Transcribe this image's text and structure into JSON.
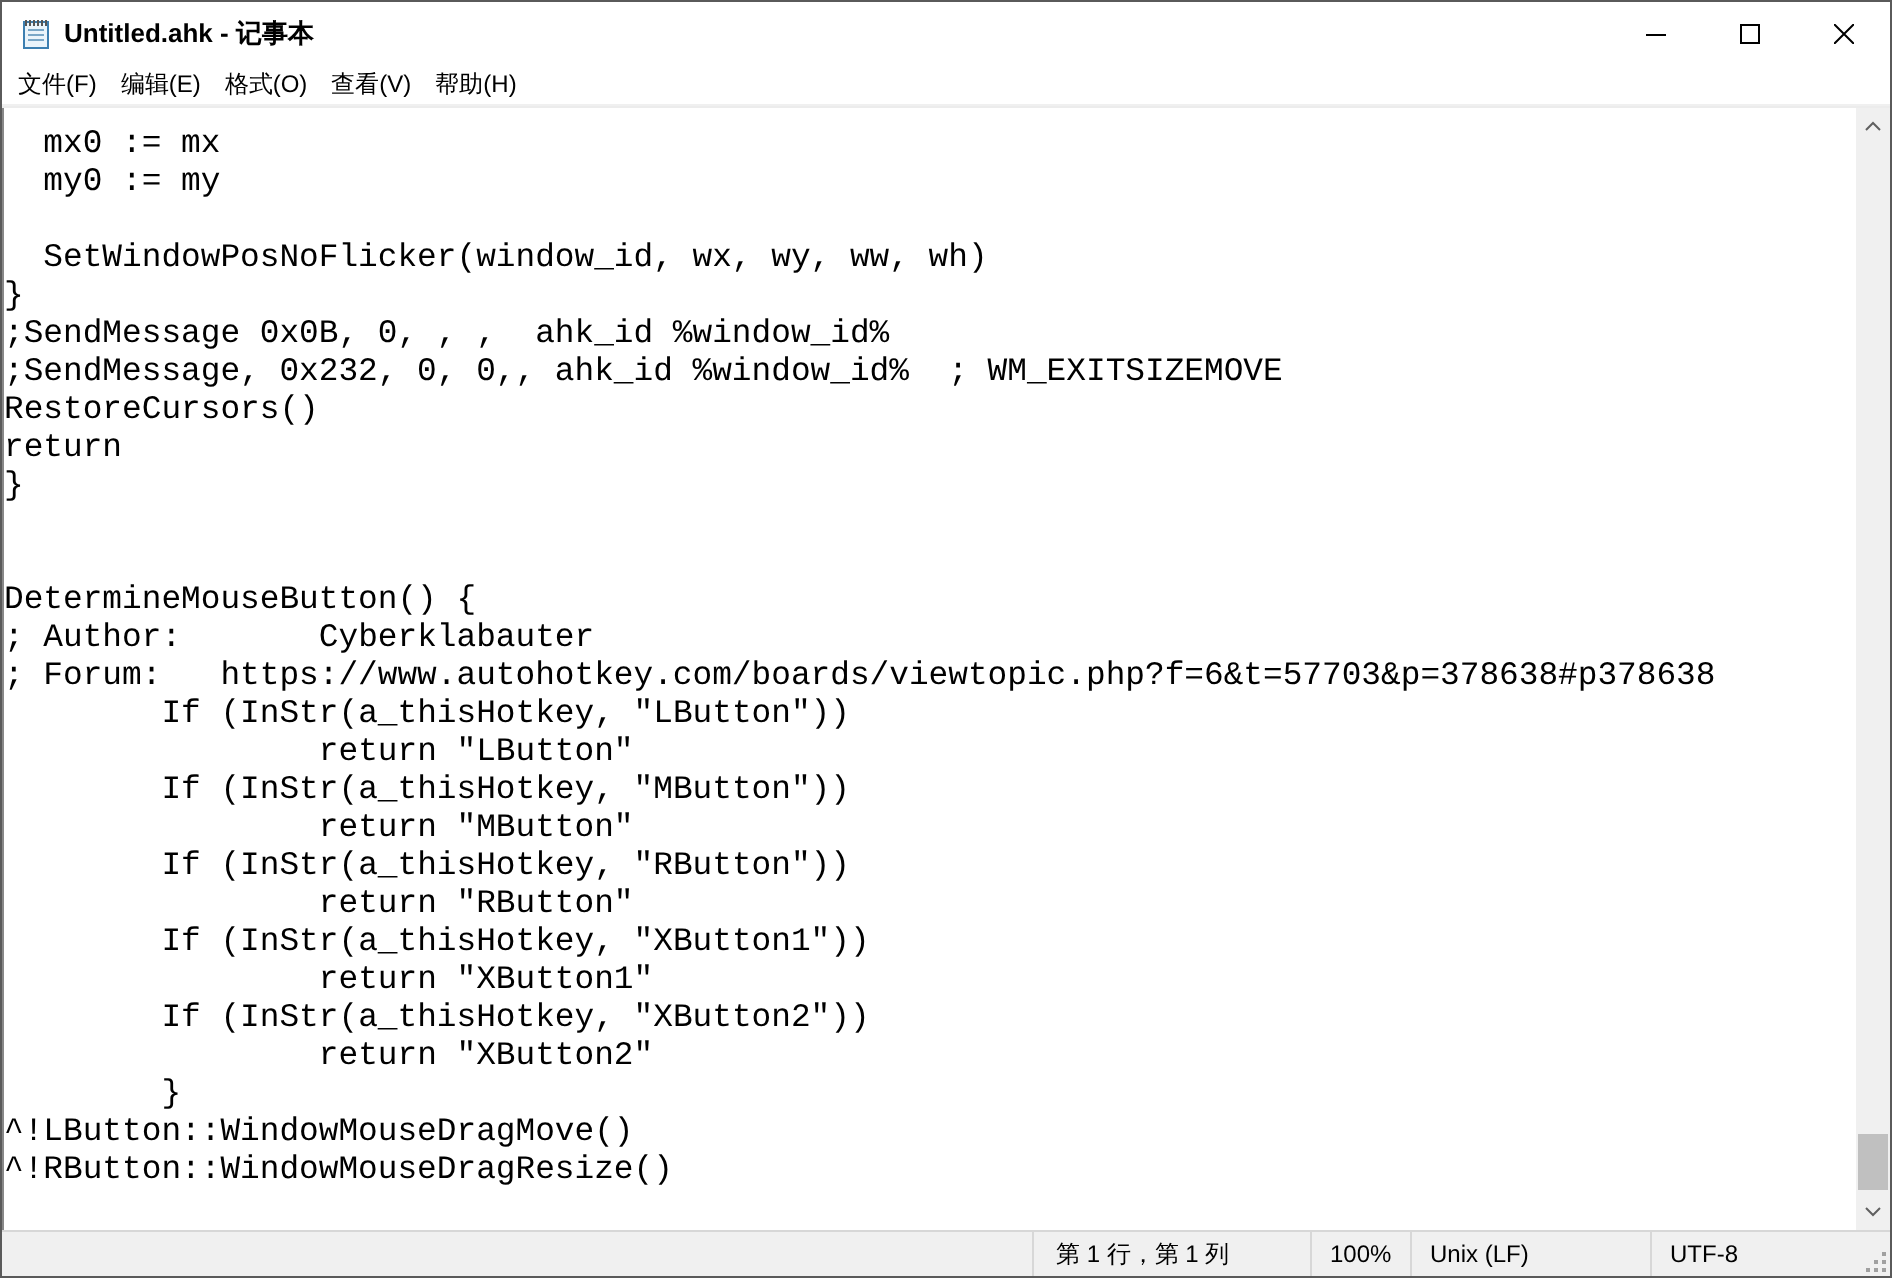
{
  "window": {
    "title": "Untitled.ahk - 记事本"
  },
  "menu": [
    "文件(F)",
    "编辑(E)",
    "格式(O)",
    "查看(V)",
    "帮助(H)"
  ],
  "editor": {
    "lines": [
      {
        "kind": "code",
        "text": "  mx0 := mx"
      },
      {
        "kind": "code",
        "text": "  my0 := my"
      },
      {
        "kind": "blank"
      },
      {
        "kind": "code",
        "text": "  SetWindowPosNoFlicker(window_id, wx, wy, ww, wh)"
      },
      {
        "kind": "code",
        "text": "}"
      },
      {
        "kind": "code",
        "text": ";SendMessage 0x0B, 0, , ,  ahk_id %window_id%"
      },
      {
        "kind": "code",
        "text": ";SendMessage, 0x232, 0, 0,, ahk_id %window_id%  ; WM_EXITSIZEMOVE"
      },
      {
        "kind": "code",
        "text": "RestoreCursors()"
      },
      {
        "kind": "code",
        "text": "return"
      },
      {
        "kind": "code",
        "text": "}"
      },
      {
        "kind": "blank"
      },
      {
        "kind": "blank"
      },
      {
        "kind": "code",
        "text": "DetermineMouseButton() {"
      },
      {
        "kind": "code",
        "text": "; Author:\tCyberklabauter"
      },
      {
        "kind": "code",
        "text": "; Forum:   https://www.autohotkey.com/boards/viewtopic.php?f=6&t=57703&p=378638#p378638"
      },
      {
        "kind": "code",
        "text": "\tIf (InStr(a_thisHotkey, \"LButton\"))"
      },
      {
        "kind": "code",
        "text": "\t\treturn \"LButton\""
      },
      {
        "kind": "code",
        "text": "\tIf (InStr(a_thisHotkey, \"MButton\"))"
      },
      {
        "kind": "code",
        "text": "\t\treturn \"MButton\""
      },
      {
        "kind": "code",
        "text": "\tIf (InStr(a_thisHotkey, \"RButton\"))"
      },
      {
        "kind": "code",
        "text": "\t\treturn \"RButton\""
      },
      {
        "kind": "code",
        "text": "\tIf (InStr(a_thisHotkey, \"XButton1\"))"
      },
      {
        "kind": "code",
        "text": "\t\treturn \"XButton1\""
      },
      {
        "kind": "code",
        "text": "\tIf (InStr(a_thisHotkey, \"XButton2\"))"
      },
      {
        "kind": "code",
        "text": "\t\treturn \"XButton2\""
      },
      {
        "kind": "code",
        "text": "\t}"
      },
      {
        "kind": "code",
        "text": "^!LButton::WindowMouseDragMove()"
      },
      {
        "kind": "code",
        "text": "^!RButton::WindowMouseDragResize()"
      }
    ]
  },
  "status_bar": [
    "第 1 行，第 1 列",
    "100%",
    "Unix (LF)",
    "UTF-8"
  ]
}
